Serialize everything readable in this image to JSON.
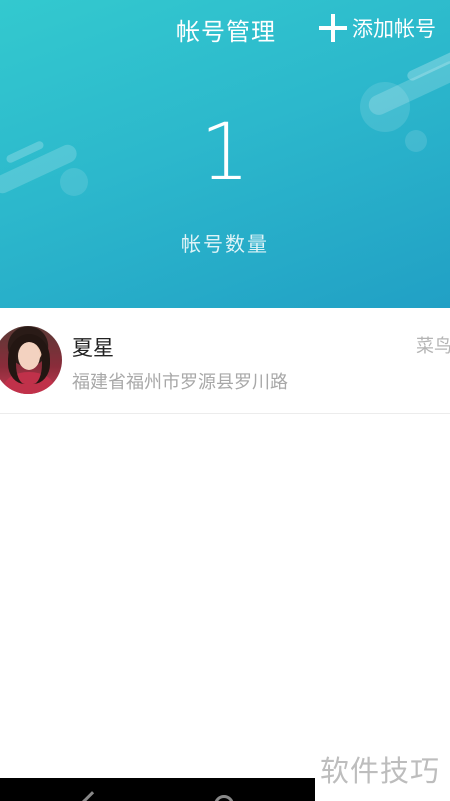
{
  "header": {
    "title": "帐号管理",
    "add_label": "添加帐号",
    "count": "1",
    "count_label": "帐号数量",
    "gradient": [
      "#33c9cf",
      "#21a0c5"
    ]
  },
  "accounts": [
    {
      "name": "夏星",
      "address": "福建省福州市罗源县罗川路",
      "tag": "菜鸟"
    }
  ],
  "watermark": "软件技巧",
  "icons": {
    "add": "plus-icon",
    "avatar": "avatar",
    "back": "back-icon",
    "home": "home-icon"
  }
}
